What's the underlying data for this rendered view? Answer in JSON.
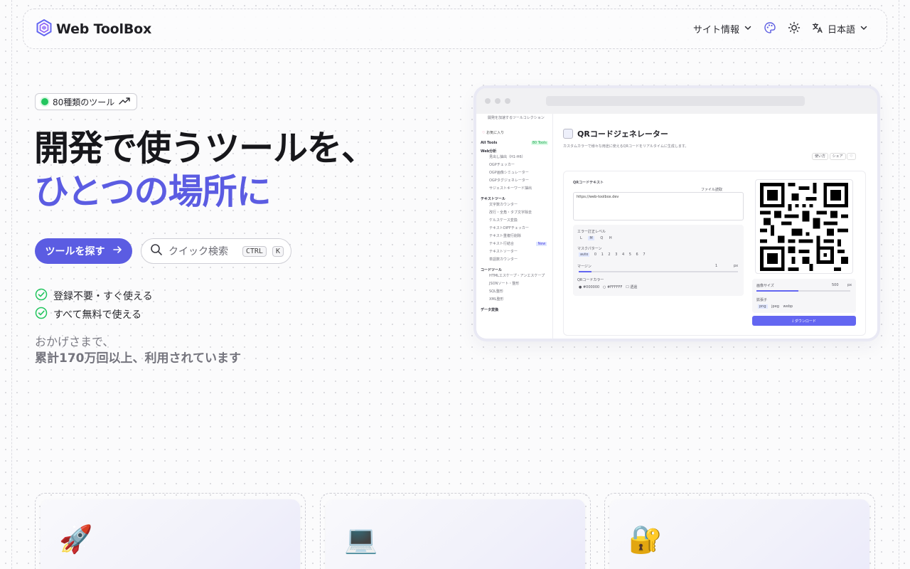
{
  "header": {
    "brand": "Web ToolBox",
    "nav": {
      "site_info": "サイト情報",
      "language": "日本語"
    },
    "icons": [
      "hexagon-logo-icon",
      "chevron-down-icon",
      "palette-icon",
      "sun-icon",
      "translate-icon",
      "chevron-down-icon"
    ]
  },
  "hero": {
    "badge": "80種類のツール",
    "title_line1": "開発で使うツールを、",
    "title_line2": "ひとつの場所に",
    "cta": "ツールを探す",
    "search_placeholder": "クイック検索",
    "shortcut": [
      "CTRL",
      "K"
    ],
    "checks": [
      "登録不要・すぐ使える",
      "すべて無料で使える"
    ],
    "thanks_line1": "おかげさまで、",
    "thanks_line2": "累計170万回以上、利用されています"
  },
  "preview": {
    "sidebar_top": "開発を加速するツールコレクション",
    "favorites": "お気に入り",
    "all_tools": "All Tools",
    "all_tools_count": "80 Tools",
    "sections": [
      {
        "title": "Web分析",
        "items": [
          "見出し抽出（H1-H6）",
          "OGPチェッカー",
          "OGP画像シミュレーター",
          "OGPタグジェネレーター",
          "サジェストキーワード抽出"
        ]
      },
      {
        "title": "テキストツール",
        "items": [
          "文字数カウンター",
          "改行・全角・タブ文字除去",
          "ケルスケース変換",
          "テキストDIFFチェッカー",
          "テキスト重複行削除",
          "テキスト行結合",
          "テキストソーター",
          "単語数カウンター"
        ]
      },
      {
        "title": "コードツール",
        "items": [
          "HTMLエスケープ・アンエスケープ",
          "JSONソート・整形",
          "SQL整形",
          "XML整形"
        ]
      },
      {
        "title": "データ変換",
        "items": []
      }
    ],
    "new_tag": "New",
    "page_title": "QRコードジェネレーター",
    "page_desc": "カスタムカラーで様々な用途に使えるQRコードをリアルタイムに生成します。",
    "share_labels": [
      "使い方",
      "シェア"
    ],
    "input_label": "QRコードテキスト",
    "file_read": "ファイル読取",
    "input_value": "https://web-toolbox.dev",
    "error_level_label": "エラー訂正レベル",
    "error_levels": [
      "L",
      "M",
      "Q",
      "H"
    ],
    "mask_label": "マスクパターン",
    "mask_values": [
      "auto",
      "0",
      "1",
      "2",
      "3",
      "4",
      "5",
      "6",
      "7"
    ],
    "margin_label": "マージン",
    "margin_value": "1",
    "margin_unit": "px",
    "color_label": "QRコードカラー",
    "color_fg": "#000000",
    "color_bg": "#FFFFFF",
    "transparent_label": "透過",
    "size_label": "画像サイズ",
    "size_value": "500",
    "size_unit": "px",
    "format_label": "拡張子",
    "formats": [
      "png",
      "jpeg",
      "webp"
    ],
    "download": "ダウンロード"
  },
  "features": {
    "cards": [
      {
        "emoji": "🚀"
      },
      {
        "emoji": "💻"
      },
      {
        "emoji": "🔐"
      }
    ]
  },
  "colors": {
    "accent": "#5b5ce2",
    "success": "#22c55e",
    "text": "#17171b"
  }
}
